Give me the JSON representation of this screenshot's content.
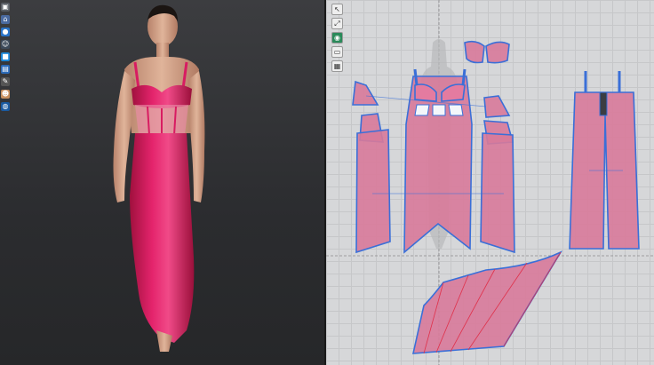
{
  "app": {
    "accent": "#e01e6b",
    "pattern_fill": "#d87a9a",
    "pattern_outline": "#3a6fd8",
    "background_3d": "#2b2c2f",
    "background_2d": "#d6d7d9"
  },
  "toolbar_3d": {
    "icons": [
      "shirt-icon",
      "hanger-icon",
      "avatar-icon",
      "person-icon",
      "fabric-icon",
      "sheet-icon",
      "pen-icon",
      "avatar-face-icon",
      "globe-icon"
    ]
  },
  "toolbar_2d": {
    "icons": [
      "select-icon",
      "transform-icon",
      "fabric-icon",
      "segment-icon",
      "internal-line-icon"
    ]
  }
}
